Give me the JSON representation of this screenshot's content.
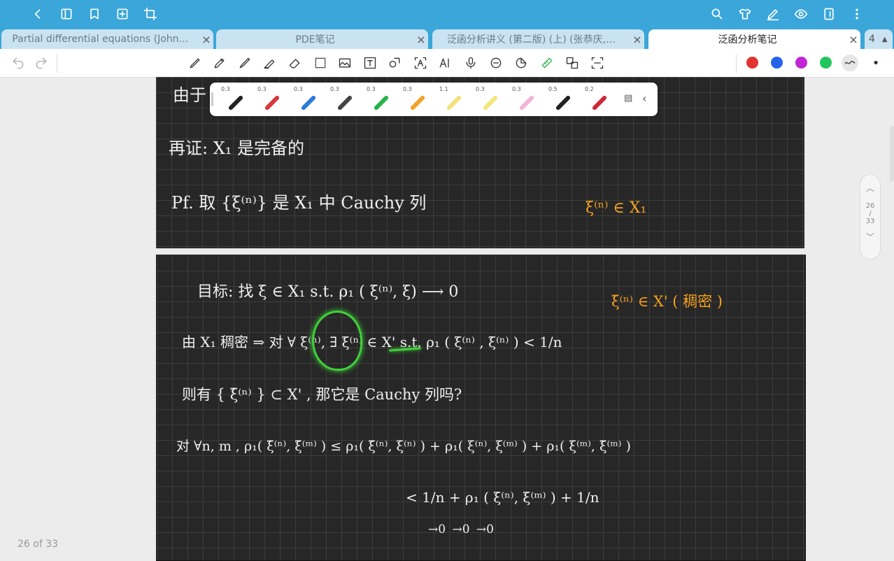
{
  "tabs": [
    {
      "label": "Partial differential equations (John…"
    },
    {
      "label": "PDE笔记"
    },
    {
      "label": "泛函分析讲义 (第二版) (上) (张恭庆,…"
    },
    {
      "label": "泛函分析笔记"
    }
  ],
  "tab_overflow_count": "4",
  "pen_widths": [
    "0.3",
    "0.3",
    "0.3",
    "0.3",
    "0.3",
    "0.3",
    "1.1",
    "0.3",
    "0.3",
    "0.5",
    "0.2"
  ],
  "pen_colors": [
    "#222222",
    "#d9363e",
    "#2b7bd9",
    "#444444",
    "#27b34a",
    "#f0a32a",
    "#f2e27a",
    "#f3e67a",
    "#f2b5d6",
    "#222222",
    "#cc2a3a"
  ],
  "palette": [
    "#e3342f",
    "#2563eb",
    "#c026d3",
    "#22c55e"
  ],
  "pager": {
    "current": "26",
    "sep": "/",
    "total": "33"
  },
  "footer": {
    "page_label": "26 of 33"
  },
  "notes": {
    "line1": "由于",
    "line2": "再证:   X₁ 是完备的",
    "line3": "Pf.   取 {ξ⁽ⁿ⁾} 是 X₁ 中 Cauchy 列",
    "side1": "ξ⁽ⁿ⁾ ∈ X₁",
    "line4": "目标:  找 ξ ∈ X₁   s.t.     ρ₁ ( ξ⁽ⁿ⁾, ξ) ⟶ 0",
    "side2": "ξ̄⁽ⁿ⁾  ∈  X' ( 稠密 )",
    "line5": "由 X₁ 稠密 ⇒ 对 ∀ ξ⁽ⁿ⁾,    ∃ ξ̄⁽ⁿ⁾  ∈ X'      s.t.   ρ₁ ( ξ⁽ⁿ⁾ ,  ξ̄⁽ⁿ⁾ )  <  1/n",
    "line6": "则有 { ξ̄⁽ⁿ⁾ }  ⊂  X' ,   那它是 Cauchy 列吗?",
    "line7": "对 ∀n, m ,  ρ₁( ξ̄⁽ⁿ⁾, ξ̄⁽ᵐ⁾ ) ≤   ρ₁( ξ̄⁽ⁿ⁾, ξ⁽ⁿ⁾ ) + ρ₁( ξ⁽ⁿ⁾, ξ⁽ᵐ⁾ ) + ρ₁( ξ⁽ᵐ⁾, ξ̄⁽ᵐ⁾ )",
    "line8": "<   1/n  +   ρ₁ ( ξ⁽ⁿ⁾, ξ⁽ᵐ⁾ ) + 1/n",
    "line9": "→0            →0             →0"
  }
}
